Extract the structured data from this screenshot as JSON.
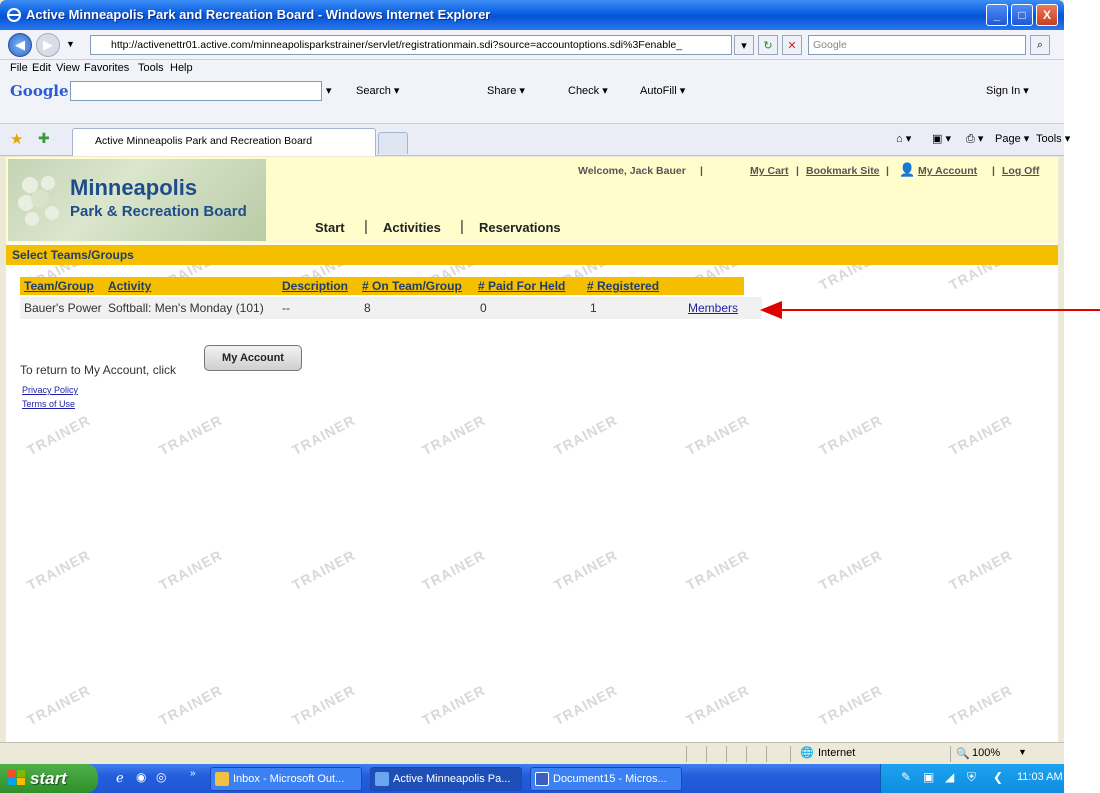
{
  "window": {
    "title": "Active Minneapolis Park and Recreation Board - Windows Internet Explorer",
    "controls": [
      "_",
      "□",
      "X"
    ]
  },
  "address_bar": {
    "url": "http://activenettr01.active.com/minneapolisparkstrainer/servlet/registrationmain.sdi?source=accountoptions.sdi%3Fenable_",
    "search_placeholder": "Google"
  },
  "menu": [
    "File",
    "Edit",
    "View",
    "Favorites",
    "Tools",
    "Help"
  ],
  "google_toolbar": {
    "logo": "Google",
    "items": [
      "Search ▾",
      "Share ▾",
      "Check ▾",
      "AutoFill ▾",
      "Sign In ▾"
    ]
  },
  "tabs": {
    "active_label": "Active Minneapolis Park and Recreation Board"
  },
  "command_bar": [
    "Page ▾",
    "Tools ▾"
  ],
  "site": {
    "logo_title": "Minneapolis",
    "logo_subtitle": "Park & Recreation Board",
    "welcome": "Welcome, Jack Bauer",
    "top_links": [
      "My Cart",
      "Bookmark Site",
      "My Account",
      "Log Off"
    ],
    "nav": [
      "Start",
      "Activities",
      "Reservations"
    ],
    "section_title": "Select Teams/Groups"
  },
  "table": {
    "headers": [
      "Team/Group",
      "Activity",
      "Description",
      "# On Team/Group",
      "# Paid For Held",
      "# Registered"
    ],
    "rows": [
      [
        "Bauer's Power",
        "Softball: Men's Monday (101)",
        "--",
        "8",
        "0",
        "1",
        "Members"
      ]
    ]
  },
  "return": {
    "text": "To return to My Account, click",
    "button_label": "My Account"
  },
  "footer_links": [
    "Privacy Policy",
    "Terms of Use"
  ],
  "watermark": "TRAINER",
  "status_bar": {
    "zone": "Internet",
    "zoom": "100%"
  },
  "taskbar": {
    "start_label": "start",
    "tasks": [
      "Inbox - Microsoft Out...",
      "Active Minneapolis Pa...",
      "Document15 - Micros..."
    ],
    "clock": "11:03 AM"
  },
  "colors": {
    "accent_yellow": "#f5bf00",
    "banner_bg": "#fffdcc",
    "link_blue": "#1f1fa8",
    "arrow_red": "#e00000"
  }
}
